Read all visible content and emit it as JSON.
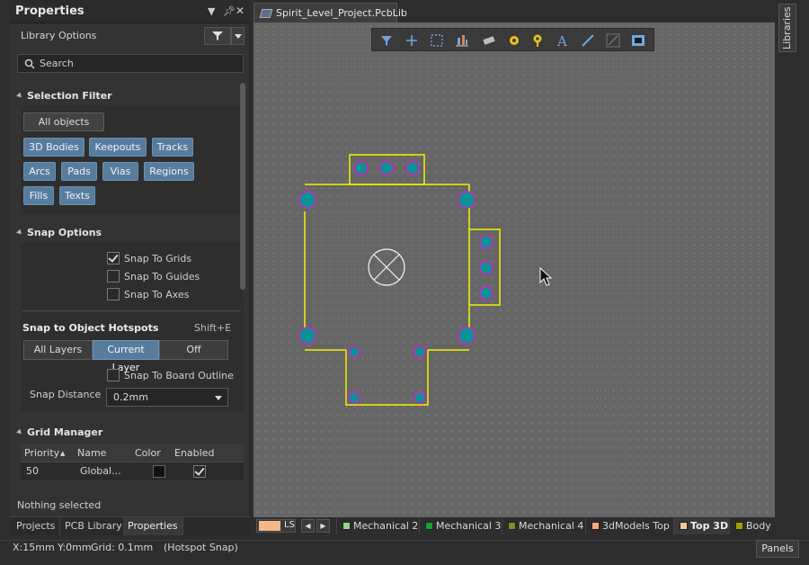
{
  "panel": {
    "title": "Properties",
    "subtitle": "Library Options",
    "search_placeholder": "Search",
    "selection_filter": {
      "title": "Selection Filter",
      "all_objects": "All objects",
      "buttons": [
        "3D Bodies",
        "Keepouts",
        "Tracks",
        "Arcs",
        "Pads",
        "Vias",
        "Regions",
        "Fills",
        "Texts"
      ]
    },
    "snap_options": {
      "title": "Snap Options",
      "checks": [
        {
          "label": "Snap To Grids",
          "checked": true
        },
        {
          "label": "Snap To Guides",
          "checked": false
        },
        {
          "label": "Snap To Axes",
          "checked": false
        }
      ],
      "hotspots_title": "Snap to Object Hotspots",
      "hotspots_shortcut": "Shift+E",
      "segments": [
        "All Layers",
        "Current Layer",
        "Off"
      ],
      "active_segment": "Current Layer",
      "board_outline": {
        "label": "Snap To Board Outline",
        "checked": false
      },
      "distance_label": "Snap Distance",
      "distance_value": "0.2mm"
    },
    "grid_manager": {
      "title": "Grid Manager",
      "columns": [
        "Priority",
        "Name",
        "Color",
        "Enabled"
      ],
      "rows": [
        {
          "priority": "50",
          "name": "Global...",
          "color": "#111111",
          "enabled": true
        }
      ]
    },
    "status": "Nothing selected",
    "tabs": [
      "Projects",
      "PCB Library",
      "Properties"
    ],
    "active_tab": "Properties"
  },
  "document": {
    "tab_title": "Spirit_Level_Project.PcbLib"
  },
  "toolbar": {
    "icons": [
      "filter-icon",
      "plus-icon",
      "select-rect-icon",
      "align-icon",
      "component-icon",
      "pad-icon",
      "via-icon",
      "text-icon",
      "line-icon",
      "dimension-icon",
      "keepout-icon"
    ]
  },
  "right_panel": {
    "tab": "Libraries"
  },
  "layers": {
    "ls_label": "LS",
    "tabs": [
      {
        "label": "Mechanical 2",
        "color": "#8fd68f"
      },
      {
        "label": "Mechanical 3",
        "color": "#17a32f"
      },
      {
        "label": "Mechanical 4",
        "color": "#8a8a1f"
      },
      {
        "label": "3dModels Top",
        "color": "#f4a87b"
      },
      {
        "label": "Top 3D",
        "color": "#f2c79a"
      },
      {
        "label": "Body I",
        "color": "#a0a000"
      }
    ],
    "active": "Top 3D"
  },
  "status_bar": {
    "coords": "X:15mm Y:0mm",
    "grid": "Grid: 0.1mm",
    "mode": "(Hotspot Snap)",
    "panels_button": "Panels"
  },
  "colors": {
    "outline": "#f2f200",
    "pad_fill": "#0a9393",
    "pad_ring": "#cc22cc",
    "accent": "#577c9e"
  }
}
